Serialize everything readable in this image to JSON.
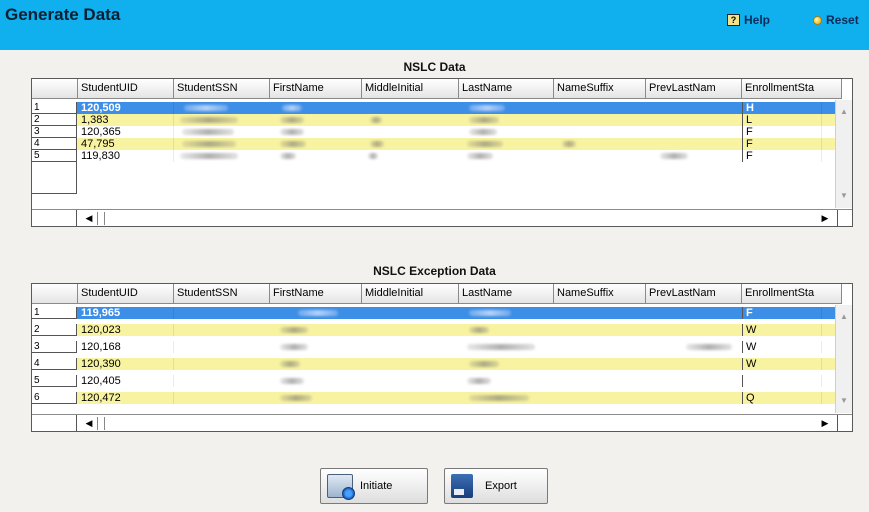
{
  "header": {
    "title": "Generate Data",
    "help_label": "Help",
    "reset_label": "Reset"
  },
  "columns": [
    "StudentUID",
    "StudentSSN",
    "FirstName",
    "MiddleInitial",
    "LastName",
    "NameSuffix",
    "PrevLastNam",
    "EnrollmentSta"
  ],
  "nslc": {
    "title": "NSLC Data",
    "rows": [
      {
        "num": "1",
        "uid": "120,509",
        "status": "H"
      },
      {
        "num": "2",
        "uid": "1,383",
        "status": "L"
      },
      {
        "num": "3",
        "uid": "120,365",
        "status": "F"
      },
      {
        "num": "4",
        "uid": "47,795",
        "status": "F"
      },
      {
        "num": "5",
        "uid": "119,830",
        "status": "F"
      }
    ]
  },
  "exception": {
    "title": "NSLC Exception Data",
    "rows": [
      {
        "num": "1",
        "uid": "119,965",
        "status": "F"
      },
      {
        "num": "2",
        "uid": "120,023",
        "status": "W"
      },
      {
        "num": "3",
        "uid": "120,168",
        "status": "W"
      },
      {
        "num": "4",
        "uid": "120,390",
        "status": "W"
      },
      {
        "num": "5",
        "uid": "120,405",
        "status": ""
      },
      {
        "num": "6",
        "uid": "120,472",
        "status": "Q"
      }
    ]
  },
  "buttons": {
    "initiate_label": "Initiate",
    "export_label": "Export"
  },
  "colors": {
    "header_bg": "#10b0ee",
    "selected_row": "#3d8ee6",
    "alt_row": "#f8f3a0"
  }
}
